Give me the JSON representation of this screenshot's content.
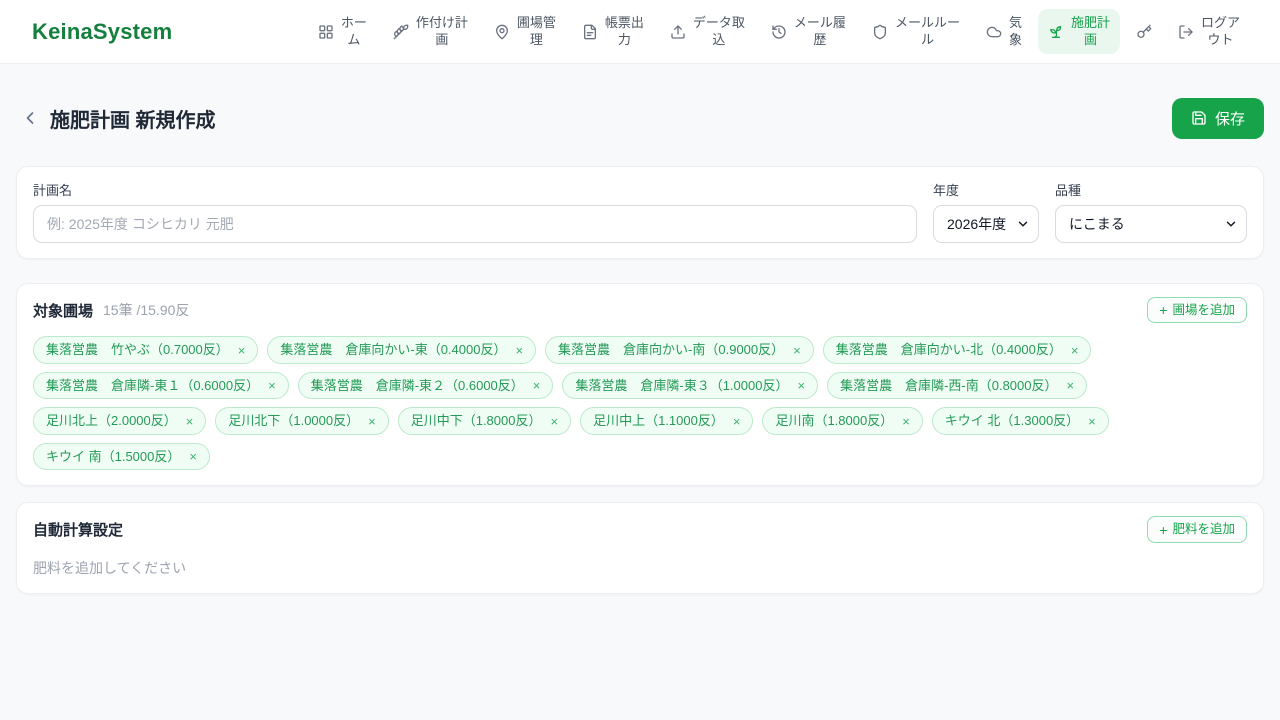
{
  "app": {
    "brand": "KeinaSystem"
  },
  "nav": {
    "items": [
      {
        "id": "home",
        "icon": "grid-icon",
        "label": "ホー\nム",
        "active": false
      },
      {
        "id": "planting-plan",
        "icon": "wheat-icon",
        "label": "作付け計\n画",
        "active": false
      },
      {
        "id": "field-management",
        "icon": "map-pin-icon",
        "label": "圃場管\n理",
        "active": false
      },
      {
        "id": "report-output",
        "icon": "document-icon",
        "label": "帳票出\n力",
        "active": false
      },
      {
        "id": "data-import",
        "icon": "upload-icon",
        "label": "データ取\n込",
        "active": false
      },
      {
        "id": "mail-history",
        "icon": "history-icon",
        "label": "メール履\n歴",
        "active": false
      },
      {
        "id": "mail-rules",
        "icon": "shield-icon",
        "label": "メールルー\nル",
        "active": false
      },
      {
        "id": "weather",
        "icon": "cloud-icon",
        "label": "気\n象",
        "active": false
      },
      {
        "id": "fertilization-plan",
        "icon": "sprout-icon",
        "label": "施肥計\n画",
        "active": true
      },
      {
        "id": "key",
        "icon": "key-icon",
        "label": "",
        "active": false
      },
      {
        "id": "logout",
        "icon": "logout-icon",
        "label": "ログア\nウト",
        "active": false
      }
    ]
  },
  "header": {
    "title": "施肥計画 新規作成",
    "save_button": "保存"
  },
  "plan_form": {
    "plan_name_label": "計画名",
    "plan_name_placeholder": "例: 2025年度 コシヒカリ 元肥",
    "plan_name_value": "",
    "year_label": "年度",
    "year_value": "2026年度",
    "variety_label": "品種",
    "variety_value": "にこまる"
  },
  "target_fields": {
    "title": "対象圃場",
    "summary": "15筆 /15.90反",
    "add_button_label": "圃場を追加",
    "chips": [
      {
        "label": "集落営農　竹やぶ（0.7000反）"
      },
      {
        "label": "集落営農　倉庫向かい-東（0.4000反）"
      },
      {
        "label": "集落営農　倉庫向かい-南（0.9000反）"
      },
      {
        "label": "集落営農　倉庫向かい-北（0.4000反）"
      },
      {
        "label": "集落営農　倉庫隣-東１（0.6000反）"
      },
      {
        "label": "集落営農　倉庫隣-東２（0.6000反）"
      },
      {
        "label": "集落営農　倉庫隣-東３（1.0000反）"
      },
      {
        "label": "集落営農　倉庫隣-西-南（0.8000反）"
      },
      {
        "label": "足川北上（2.0000反）"
      },
      {
        "label": "足川北下（1.0000反）"
      },
      {
        "label": "足川中下（1.8000反）"
      },
      {
        "label": "足川中上（1.1000反）"
      },
      {
        "label": "足川南（1.8000反）"
      },
      {
        "label": "キウイ 北（1.3000反）"
      },
      {
        "label": "キウイ 南（1.5000反）"
      }
    ]
  },
  "auto_calc": {
    "title": "自動計算設定",
    "add_button_label": "肥料を追加",
    "empty_message": "肥料を追加してください"
  },
  "glyphs": {
    "plus": "+",
    "close": "×"
  },
  "colors": {
    "brand_green": "#15803d",
    "accent_green": "#16a34a",
    "active_nav_bg": "#e9f7ef",
    "chip_bg": "#f0fdf4",
    "chip_border": "#bbe9cc",
    "page_bg": "#f8f9fa"
  }
}
